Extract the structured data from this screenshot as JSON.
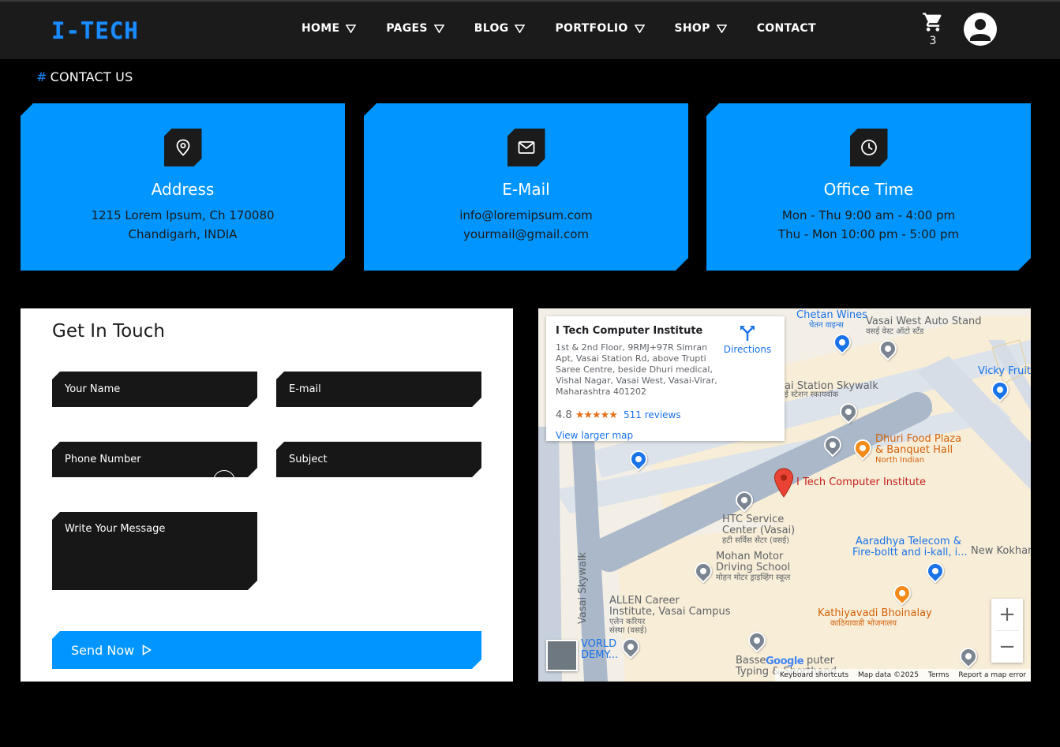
{
  "header": {
    "logo": "I-TECH",
    "nav": [
      {
        "label": "HOME",
        "dropdown": true
      },
      {
        "label": "PAGES",
        "dropdown": true
      },
      {
        "label": "BLOG",
        "dropdown": true
      },
      {
        "label": "PORTFOLIO",
        "dropdown": true
      },
      {
        "label": "SHOP",
        "dropdown": true
      },
      {
        "label": "CONTACT",
        "dropdown": false
      }
    ],
    "cart_count": "3"
  },
  "breadcrumb": {
    "hash": "#",
    "label": "CONTACT US"
  },
  "cards": [
    {
      "icon": "location-pin-icon",
      "title": "Address",
      "line1": "1215 Lorem Ipsum, Ch 170080",
      "line2": "Chandigarh, INDIA"
    },
    {
      "icon": "envelope-icon",
      "title": "E-Mail",
      "line1": "info@loremipsum.com",
      "line2": "yourmail@gmail.com"
    },
    {
      "icon": "clock-icon",
      "title": "Office Time",
      "line1": "Mon - Thu 9:00 am - 4:00 pm",
      "line2": "Thu - Mon 10:00 pm - 5:00 pm"
    }
  ],
  "form": {
    "title": "Get In Touch",
    "name_placeholder": "Your Name",
    "email_placeholder": "E-mail",
    "phone_placeholder": "Phone Number",
    "subject_placeholder": "Subject",
    "message_placeholder": "Write Your Message",
    "send_label": "Send Now"
  },
  "map": {
    "place_name": "I Tech Computer Institute",
    "address": "1st & 2nd Floor, 9RMJ+97R Simran Apt, Vasai Station Rd, above Trupti Saree Centre, beside Dhuri medical, Vishal Nagar, Vasai West, Vasai-Virar, Maharashtra 401202",
    "rating": "4.8",
    "stars": "★★★★★",
    "reviews": "511 reviews",
    "directions": "Directions",
    "view_larger": "View larger map",
    "labels": {
      "chetan_wines": "Chetan Wines",
      "chetan_wines_mr": "चेतन वाइन्स",
      "auto_stand": "Vasai West Auto Stand",
      "auto_stand_mr": "वसई वेस्ट ऑटो स्टँड",
      "vicky_fruit": "Vicky Fruit",
      "skywalk_station": "ai Station Skywalk",
      "skywalk_station_mr": "ई स्टेशन स्कायवॉक",
      "dhuri_food": "Dhuri Food Plaza",
      "dhuri_food2": "& Banquet Hall",
      "north_indian": "North Indian",
      "itech_pin": "I Tech Computer Institute",
      "htc1": "HTC Service",
      "htc2": "Center (Vasai)",
      "htc_mr": "हटी सर्विस सेंटर (वसई)",
      "aaradhya1": "Aaradhya Telecom &",
      "aaradhya2": "Fire-boltt and i-kall, i...",
      "new_kokhan": "New Kokhan",
      "mohan1": "Mohan Motor",
      "mohan2": "Driving School",
      "mohan_mr": "मोहन मोटर ड्राइव्हिंग स्कूल",
      "vasai_skywalk": "Vasai Skywalk",
      "allen1": "ALLEN Career",
      "allen2": "Institute, Vasai Campus",
      "allen_mr1": "एलेन करियर",
      "allen_mr2": "संस्था (वसई)",
      "kathiyavadi": "Kathiyavadi Bhoinalay",
      "kathiyavadi_mr": "काठियावाडी भोजनालय",
      "world1": "VORLD",
      "world2": "DEMY...",
      "basse1": "Basse",
      "basse2": "puter",
      "typing": "Typing & Shorthand"
    },
    "footer": {
      "keyboard": "Keyboard shortcuts",
      "map_data": "Map data ©2025",
      "terms": "Terms",
      "report": "Report a map error"
    },
    "zoom_in": "+",
    "zoom_out": "−",
    "google": "Google"
  }
}
